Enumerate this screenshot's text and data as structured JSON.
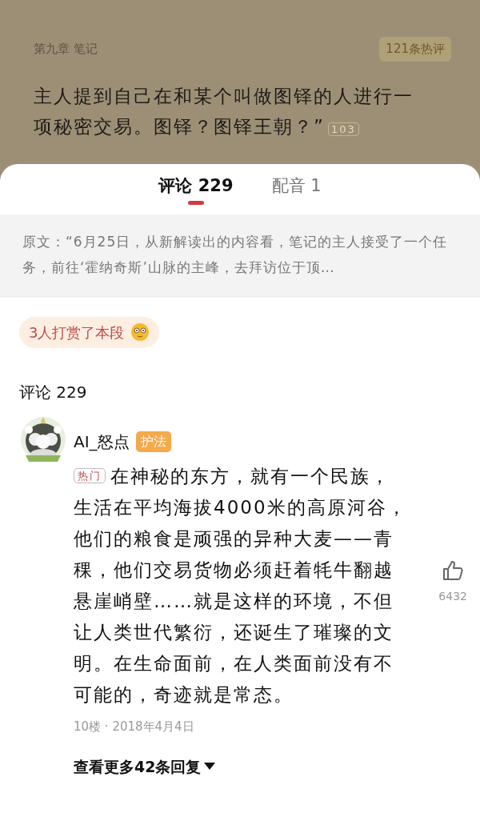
{
  "reader": {
    "chapter": "第九章 笔记",
    "hot_comments": "121条热评",
    "lines": [
      "主人提到自己在和某个叫做图铎的人进行一",
      "项秘密交易。图铎？图铎王朝？”"
    ],
    "paragraph_comment_count": "103"
  },
  "tabs": [
    {
      "label": "评论 229",
      "selected": true
    },
    {
      "label": "配音 1",
      "selected": false
    }
  ],
  "quote": "原文：“6月25日，从新解读出的内容看，笔记的主人接受了一个任务，前往‘霍纳奇斯’山脉的主峰，去拜访位于顶…",
  "tip_banner": "3人打赏了本段",
  "section_title": "评论 229",
  "comments": [
    {
      "username": "AI_怒点",
      "role_badge": "护法",
      "tag": "热门",
      "text": "在神秘的东方，就有一个民族，生活在平均海拔4000米的高原河谷，他们的粮食是顽强的异种大麦——青稞，他们交易货物必须赶着牦牛翻越悬崖峭壁……就是这样的环境，不但让人类世代繁衍，还诞生了璀璨的文明。在生命面前，在人类面前没有不可能的，奇迹就是常态。",
      "meta": "10楼 · 2018年4月4日",
      "likes": "6432",
      "more_replies": "查看更多42条回复"
    }
  ]
}
